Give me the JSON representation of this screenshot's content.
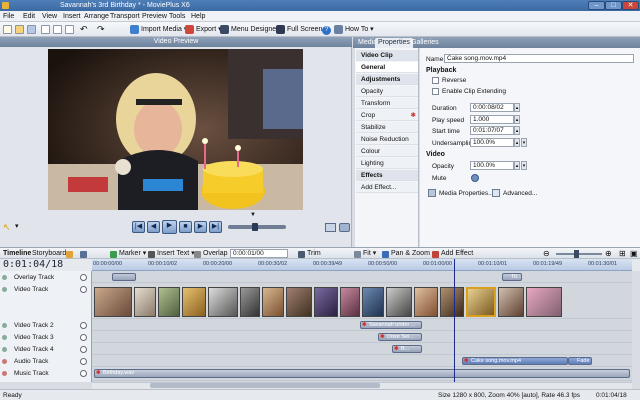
{
  "window": {
    "title": "Savannah's 3rd Birthday * - MoviePlus X6"
  },
  "menu": [
    "File",
    "Edit",
    "View",
    "Insert",
    "Arrange",
    "Transport",
    "Preview",
    "Tools",
    "Help"
  ],
  "toolbar": {
    "import_media": "Import Media",
    "export": "Export",
    "menu_designer": "Menu Designer",
    "full_screen": "Full Screen",
    "how_to": "How To"
  },
  "preview": {
    "header": "Video Preview"
  },
  "right_tabs": [
    "Media",
    "Properties",
    "Galleries"
  ],
  "prop_list": {
    "items": [
      "Video Clip",
      "General",
      "Adjustments",
      "Opacity",
      "Transform",
      "Crop",
      "Stabilize",
      "Noise Reduction",
      "Colour",
      "Lighting",
      "Effects",
      "Add Effect..."
    ]
  },
  "props": {
    "name_label": "Name",
    "name_value": "Cake song.mov.mp4",
    "playback_header": "Playback",
    "reverse_label": "Reverse",
    "extending_label": "Enable Clip Extending",
    "duration_label": "Duration",
    "duration_value": "0:00:08/02",
    "speed_label": "Play speed",
    "speed_value": "1.000",
    "start_label": "Start time",
    "start_value": "0:01:07/07",
    "under_label": "Undersampling",
    "under_value": "100.0%",
    "video_header": "Video",
    "opacity_label": "Opacity",
    "opacity_value": "100.0%",
    "mute_label": "Mute",
    "media_props": "Media Properties...",
    "advanced": "Advanced..."
  },
  "timeline_toolbar": {
    "tab_timeline": "Timeline",
    "tab_storyboard": "Storyboard",
    "marker": "Marker",
    "insert_text": "Insert Text",
    "overlap_label": "Overlap",
    "overlap_value": "0:00:01/00",
    "trim": "Trim",
    "fit": "Fit",
    "pan_zoom": "Pan & Zoom",
    "add_effect": "Add Effect"
  },
  "timecode": "0:01:04/18",
  "ruler_ticks": [
    "00:00:00/00",
    "00:00:10/02",
    "00:00:20/00",
    "00:00:30/02",
    "00:00:39/49",
    "00:00:50/00",
    "00:01:00/00",
    "00:01:10/01",
    "00:01:19/49",
    "00:01:30/01"
  ],
  "tracks": [
    "Overlay Track",
    "Video Track",
    "Video Track 2",
    "Video Track 3",
    "Video Track 4",
    "Audio Track",
    "Music Track"
  ],
  "clips": {
    "overlay_a": "",
    "overlay_b": "Tit...",
    "v2": "Savannah under ...",
    "v3": "Dove Sei...",
    "v4": "B...",
    "audio": "Cake song.mov.mp4",
    "audio2": "Fade",
    "music": "Birthday.wav"
  },
  "statusbar": {
    "left": "Ready",
    "center": "Size 1280 x 800, Zoom 40% [auto], Rate 46.3 fps",
    "right": "0:01:04/18"
  },
  "colors": {
    "accent": "#3b6aa3",
    "clip": "#96a3ba",
    "playhead": "#1b2a8f"
  }
}
